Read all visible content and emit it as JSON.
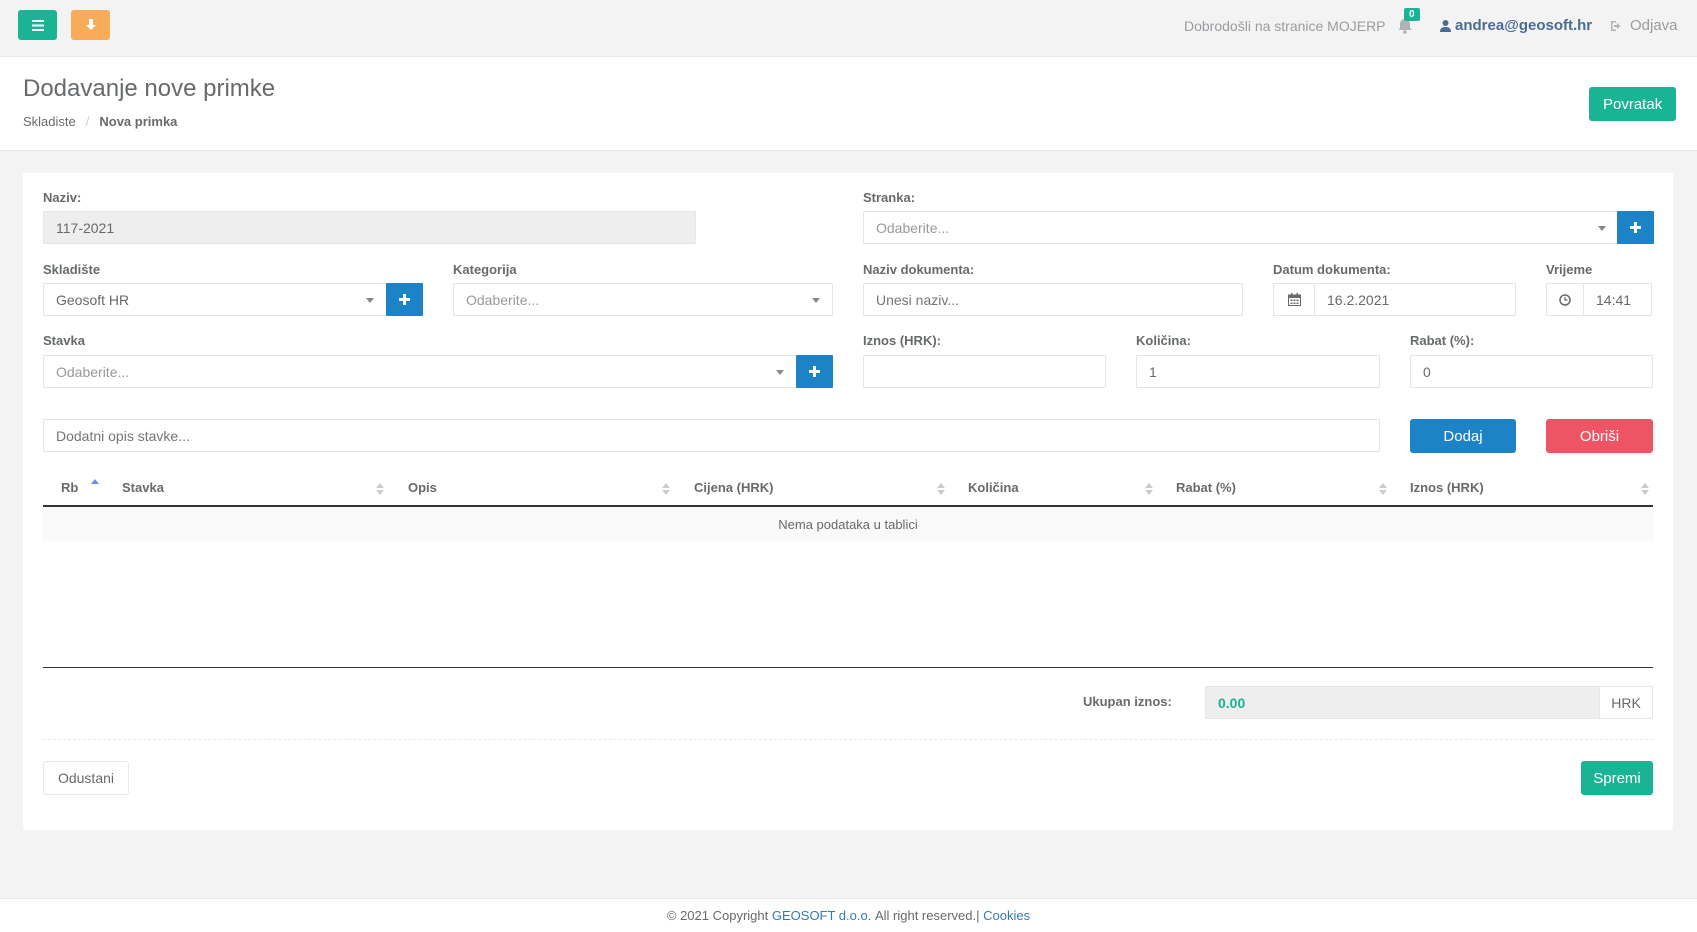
{
  "topbar": {
    "welcome": "Dobrodošli na stranice MOJERP",
    "notification_count": "0",
    "user_email": "andrea@geosoft.hr",
    "logout": "Odjava"
  },
  "heading": {
    "title": "Dodavanje nove primke",
    "breadcrumb": [
      "Skladiste",
      "Nova primka"
    ],
    "back_button": "Povratak"
  },
  "form": {
    "naziv": {
      "label": "Naziv:",
      "value": "117-2021"
    },
    "stranka": {
      "label": "Stranka:",
      "placeholder": "Odaberite..."
    },
    "skladiste": {
      "label": "Skladište",
      "value": "Geosoft HR"
    },
    "kategorija": {
      "label": "Kategorija",
      "placeholder": "Odaberite..."
    },
    "naziv_dokumenta": {
      "label": "Naziv dokumenta:",
      "placeholder": "Unesi naziv..."
    },
    "datum_dokumenta": {
      "label": "Datum dokumenta:",
      "value": "16.2.2021"
    },
    "vrijeme": {
      "label": "Vrijeme",
      "value": "14:41"
    },
    "stavka": {
      "label": "Stavka",
      "placeholder": "Odaberite..."
    },
    "iznos": {
      "label": "Iznos (HRK):",
      "value": ""
    },
    "kolicina": {
      "label": "Količina:",
      "value": "1"
    },
    "rabat": {
      "label": "Rabat (%):",
      "value": "0"
    },
    "opis": {
      "placeholder": "Dodatni opis stavke..."
    },
    "add_button": "Dodaj",
    "delete_button": "Obriši"
  },
  "table": {
    "columns": [
      "Rb",
      "Stavka",
      "Opis",
      "Cijena (HRK)",
      "Količina",
      "Rabat (%)",
      "Iznos (HRK)"
    ],
    "empty_text": "Nema podataka u tablici"
  },
  "totals": {
    "label": "Ukupan iznos:",
    "value": "0.00",
    "currency": "HRK"
  },
  "actions": {
    "cancel": "Odustani",
    "save": "Spremi"
  },
  "footer": {
    "prefix": "© 2021 Copyright",
    "company": "GEOSOFT d.o.o.",
    "rights": "All right reserved.|",
    "cookies": "Cookies"
  },
  "colors": {
    "primary": "#1ab394",
    "warning": "#f8ac59",
    "info": "#1c84c6",
    "danger": "#ed5565"
  }
}
